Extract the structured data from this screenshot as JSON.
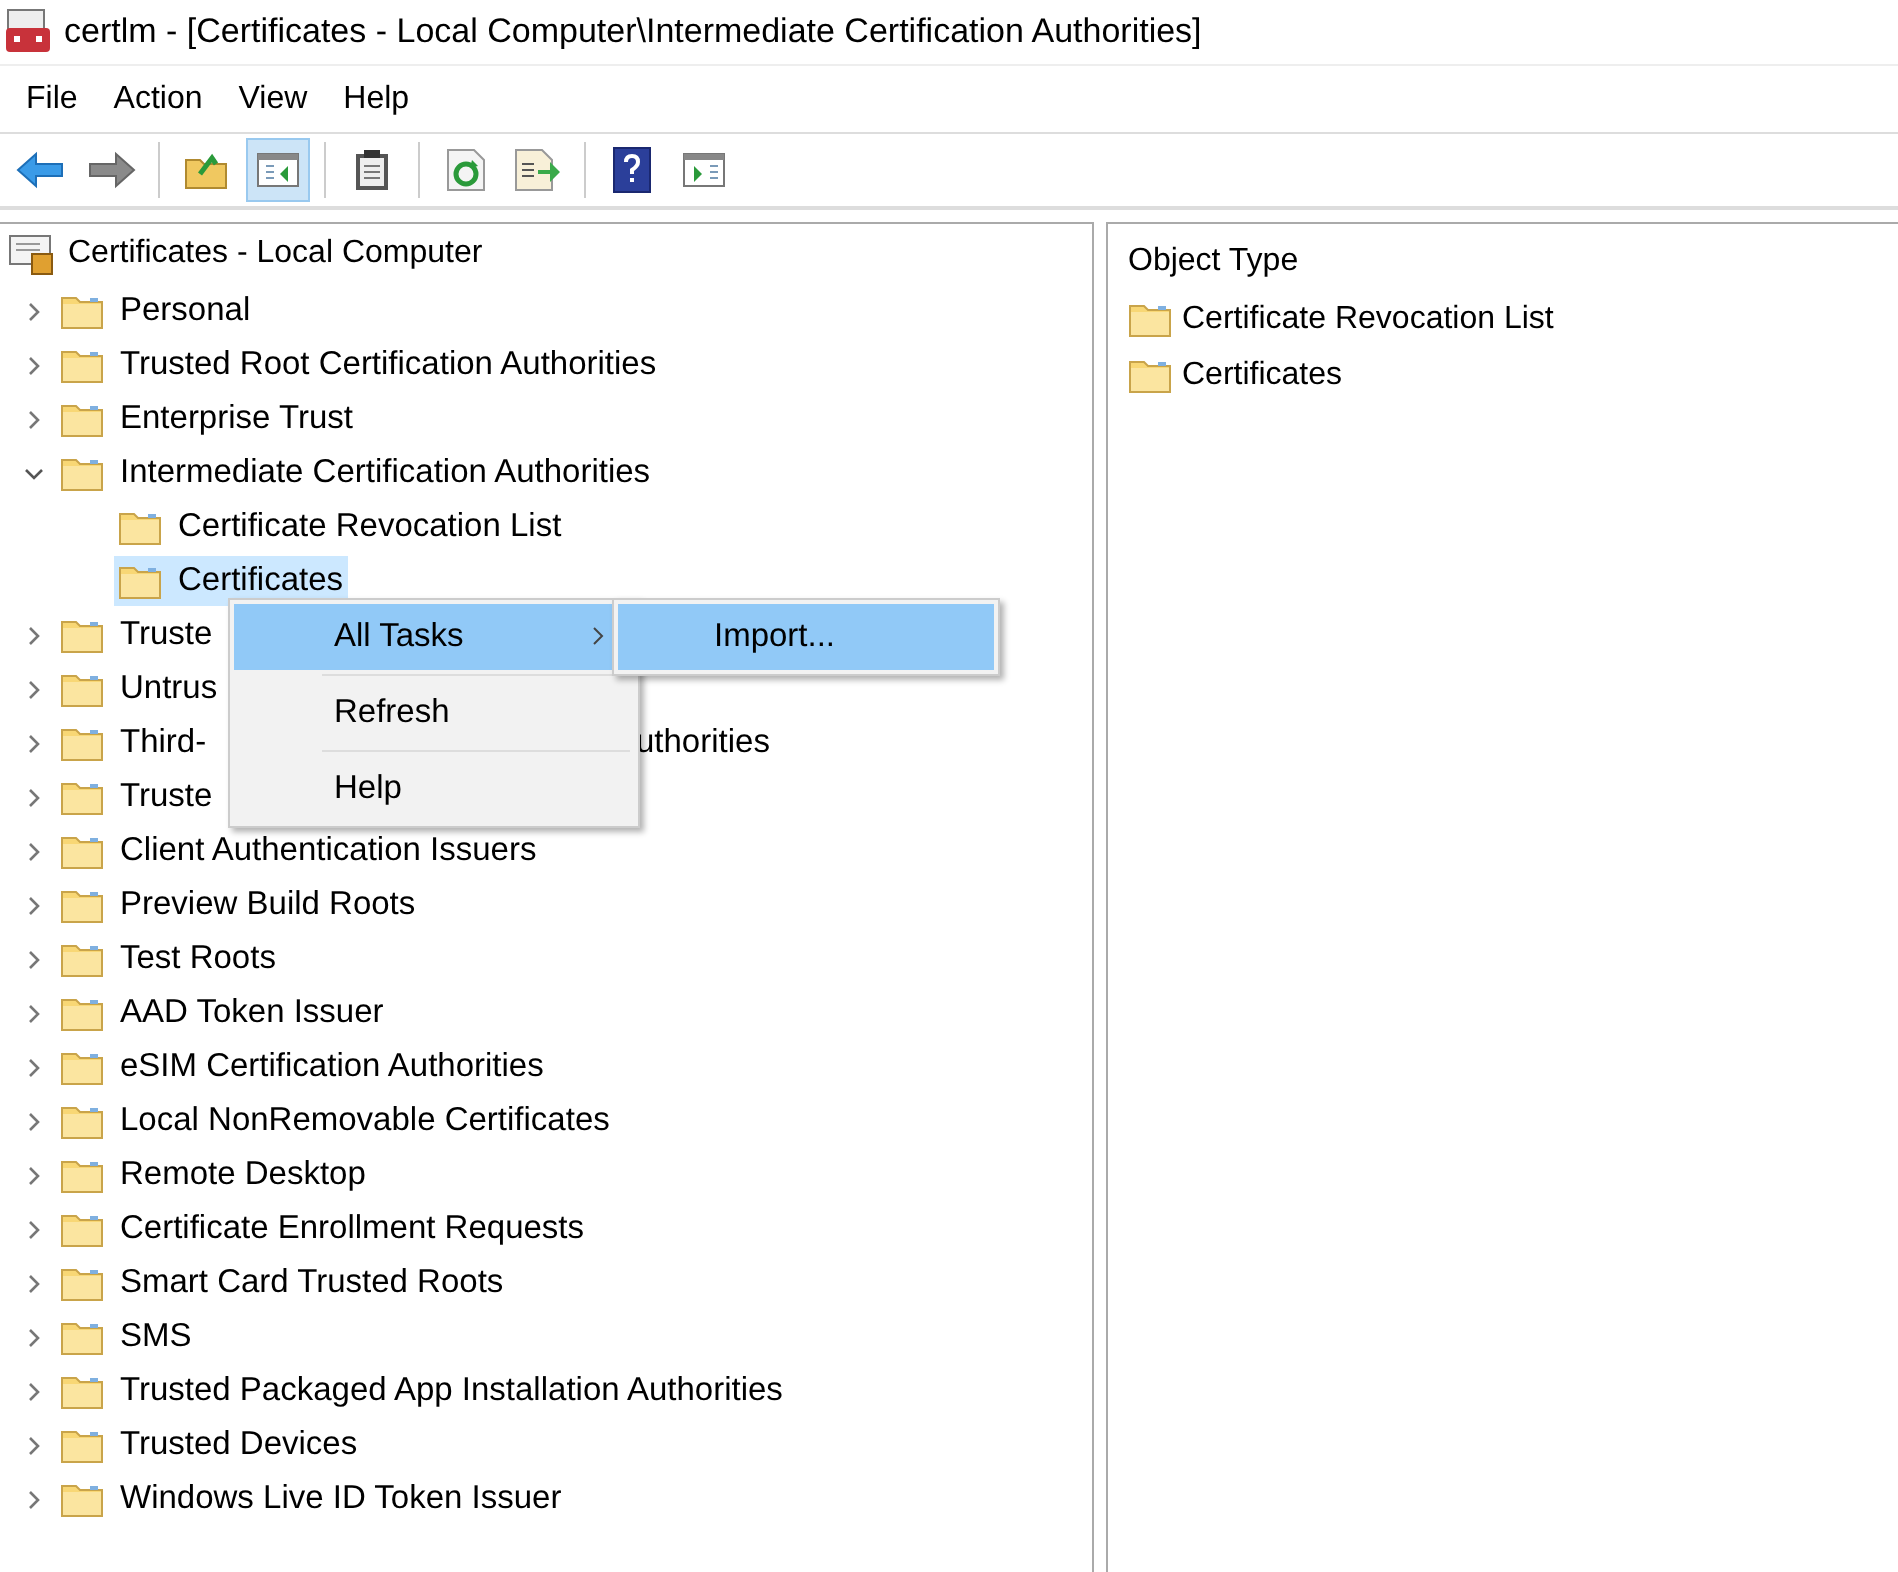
{
  "window": {
    "title": "certlm - [Certificates - Local Computer\\Intermediate Certification Authorities]"
  },
  "menu_bar": [
    "File",
    "Action",
    "View",
    "Help"
  ],
  "toolbar": [
    {
      "kind": "back",
      "pressed": false
    },
    {
      "kind": "forward",
      "pressed": false
    },
    {
      "kind": "separator"
    },
    {
      "kind": "up",
      "pressed": false
    },
    {
      "kind": "tree_toggle",
      "pressed": true
    },
    {
      "kind": "separator"
    },
    {
      "kind": "properties",
      "pressed": false
    },
    {
      "kind": "separator"
    },
    {
      "kind": "refresh",
      "pressed": false
    },
    {
      "kind": "export",
      "pressed": false
    },
    {
      "kind": "separator"
    },
    {
      "kind": "help",
      "pressed": false
    },
    {
      "kind": "action_pane",
      "pressed": false
    }
  ],
  "tree": {
    "label": "Certificates - Local Computer",
    "children": [
      {
        "label": "Personal",
        "expanded": false,
        "selected": false
      },
      {
        "label": "Trusted Root Certification Authorities",
        "expanded": false,
        "selected": false
      },
      {
        "label": "Enterprise Trust",
        "expanded": false,
        "selected": false
      },
      {
        "label": "Intermediate Certification Authorities",
        "expanded": true,
        "selected": false,
        "children": [
          {
            "label": "Certificate Revocation List",
            "selected": false
          },
          {
            "label": "Certificates",
            "selected": true
          }
        ]
      },
      {
        "label": "Truste",
        "expanded": false,
        "selected": false
      },
      {
        "label": "Untrus",
        "expanded": false,
        "selected": false
      },
      {
        "label": "Third-",
        "tail": "uthorities",
        "expanded": false,
        "selected": false
      },
      {
        "label": "Truste",
        "expanded": false,
        "selected": false
      },
      {
        "label": "Client Authentication Issuers",
        "expanded": false,
        "selected": false
      },
      {
        "label": "Preview Build Roots",
        "expanded": false,
        "selected": false
      },
      {
        "label": "Test Roots",
        "expanded": false,
        "selected": false
      },
      {
        "label": "AAD Token Issuer",
        "expanded": false,
        "selected": false
      },
      {
        "label": "eSIM Certification Authorities",
        "expanded": false,
        "selected": false
      },
      {
        "label": "Local NonRemovable Certificates",
        "expanded": false,
        "selected": false
      },
      {
        "label": "Remote Desktop",
        "expanded": false,
        "selected": false
      },
      {
        "label": "Certificate Enrollment Requests",
        "expanded": false,
        "selected": false
      },
      {
        "label": "Smart Card Trusted Roots",
        "expanded": false,
        "selected": false
      },
      {
        "label": "SMS",
        "expanded": false,
        "selected": false
      },
      {
        "label": "Trusted Packaged App Installation Authorities",
        "expanded": false,
        "selected": false
      },
      {
        "label": "Trusted Devices",
        "expanded": false,
        "selected": false
      },
      {
        "label": "Windows Live ID Token Issuer",
        "expanded": false,
        "selected": false
      }
    ]
  },
  "context_menu": {
    "items": [
      {
        "kind": "item",
        "label": "All Tasks",
        "selected": true,
        "submenu": true
      },
      {
        "kind": "separator"
      },
      {
        "kind": "item",
        "label": "Refresh",
        "selected": false,
        "submenu": false
      },
      {
        "kind": "separator"
      },
      {
        "kind": "item",
        "label": "Help",
        "selected": false,
        "submenu": false
      }
    ],
    "submenu": [
      {
        "label": "Import...",
        "selected": true
      }
    ]
  },
  "list": {
    "header": "Object Type",
    "items": [
      {
        "label": "Certificate Revocation List"
      },
      {
        "label": "Certificates"
      }
    ]
  }
}
